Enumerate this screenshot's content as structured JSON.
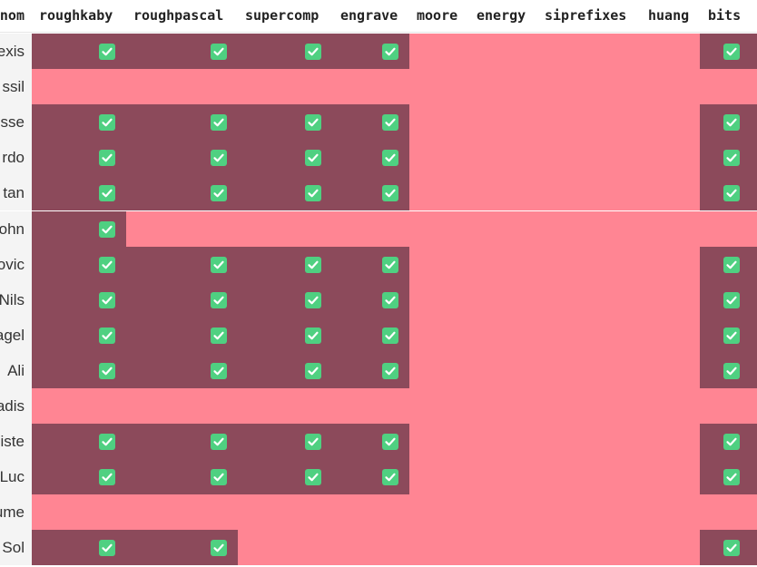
{
  "columns": [
    {
      "id": "nom",
      "label": "nom"
    },
    {
      "id": "roughkaby",
      "label": "roughkaby"
    },
    {
      "id": "roughpascal",
      "label": "roughpascal"
    },
    {
      "id": "supercomp",
      "label": "supercomp"
    },
    {
      "id": "engrave",
      "label": "engrave"
    },
    {
      "id": "moore",
      "label": "moore"
    },
    {
      "id": "energy",
      "label": "energy"
    },
    {
      "id": "siprefixes",
      "label": "siprefixes"
    },
    {
      "id": "huang",
      "label": "huang"
    },
    {
      "id": "bits",
      "label": "bits"
    }
  ],
  "rows": [
    {
      "name": "exis",
      "values": [
        1,
        1,
        1,
        1,
        0,
        0,
        0,
        0,
        1
      ]
    },
    {
      "name": "ssil",
      "values": [
        0,
        0,
        0,
        0,
        0,
        0,
        0,
        0,
        0
      ]
    },
    {
      "name": "sse",
      "values": [
        1,
        1,
        1,
        1,
        0,
        0,
        0,
        0,
        1
      ]
    },
    {
      "name": "rdo",
      "values": [
        1,
        1,
        1,
        1,
        0,
        0,
        0,
        0,
        1
      ]
    },
    {
      "name": "tan",
      "values": [
        1,
        1,
        1,
        1,
        0,
        0,
        0,
        0,
        1
      ]
    },
    {
      "name": "ohn",
      "values": [
        1,
        0,
        0,
        0,
        0,
        0,
        0,
        0,
        0
      ]
    },
    {
      "name": "ovic",
      "values": [
        1,
        1,
        1,
        1,
        0,
        0,
        0,
        0,
        1
      ]
    },
    {
      "name": "Nils",
      "values": [
        1,
        1,
        1,
        1,
        0,
        0,
        0,
        0,
        1
      ]
    },
    {
      "name": "agel",
      "values": [
        1,
        1,
        1,
        1,
        0,
        0,
        0,
        0,
        1
      ]
    },
    {
      "name": "Ali",
      "values": [
        1,
        1,
        1,
        1,
        0,
        0,
        0,
        0,
        1
      ]
    },
    {
      "name": "adis",
      "values": [
        0,
        0,
        0,
        0,
        0,
        0,
        0,
        0,
        0
      ]
    },
    {
      "name": "iste",
      "values": [
        1,
        1,
        1,
        1,
        0,
        0,
        0,
        0,
        1
      ]
    },
    {
      "name": "Luc",
      "values": [
        1,
        1,
        1,
        1,
        0,
        0,
        0,
        0,
        1
      ]
    },
    {
      "name": "ume",
      "values": [
        0,
        0,
        0,
        0,
        0,
        0,
        0,
        0,
        0
      ]
    },
    {
      "name": "Sol",
      "values": [
        1,
        1,
        0,
        0,
        0,
        0,
        0,
        0,
        1
      ]
    }
  ],
  "colors": {
    "checked_bg": "#8c4a5b",
    "unchecked_bg": "#ff8593",
    "checkbox": "#4fd081",
    "name_bg": "#f4f4f4"
  },
  "icons": {
    "checked": "checkbox-checked-icon"
  }
}
